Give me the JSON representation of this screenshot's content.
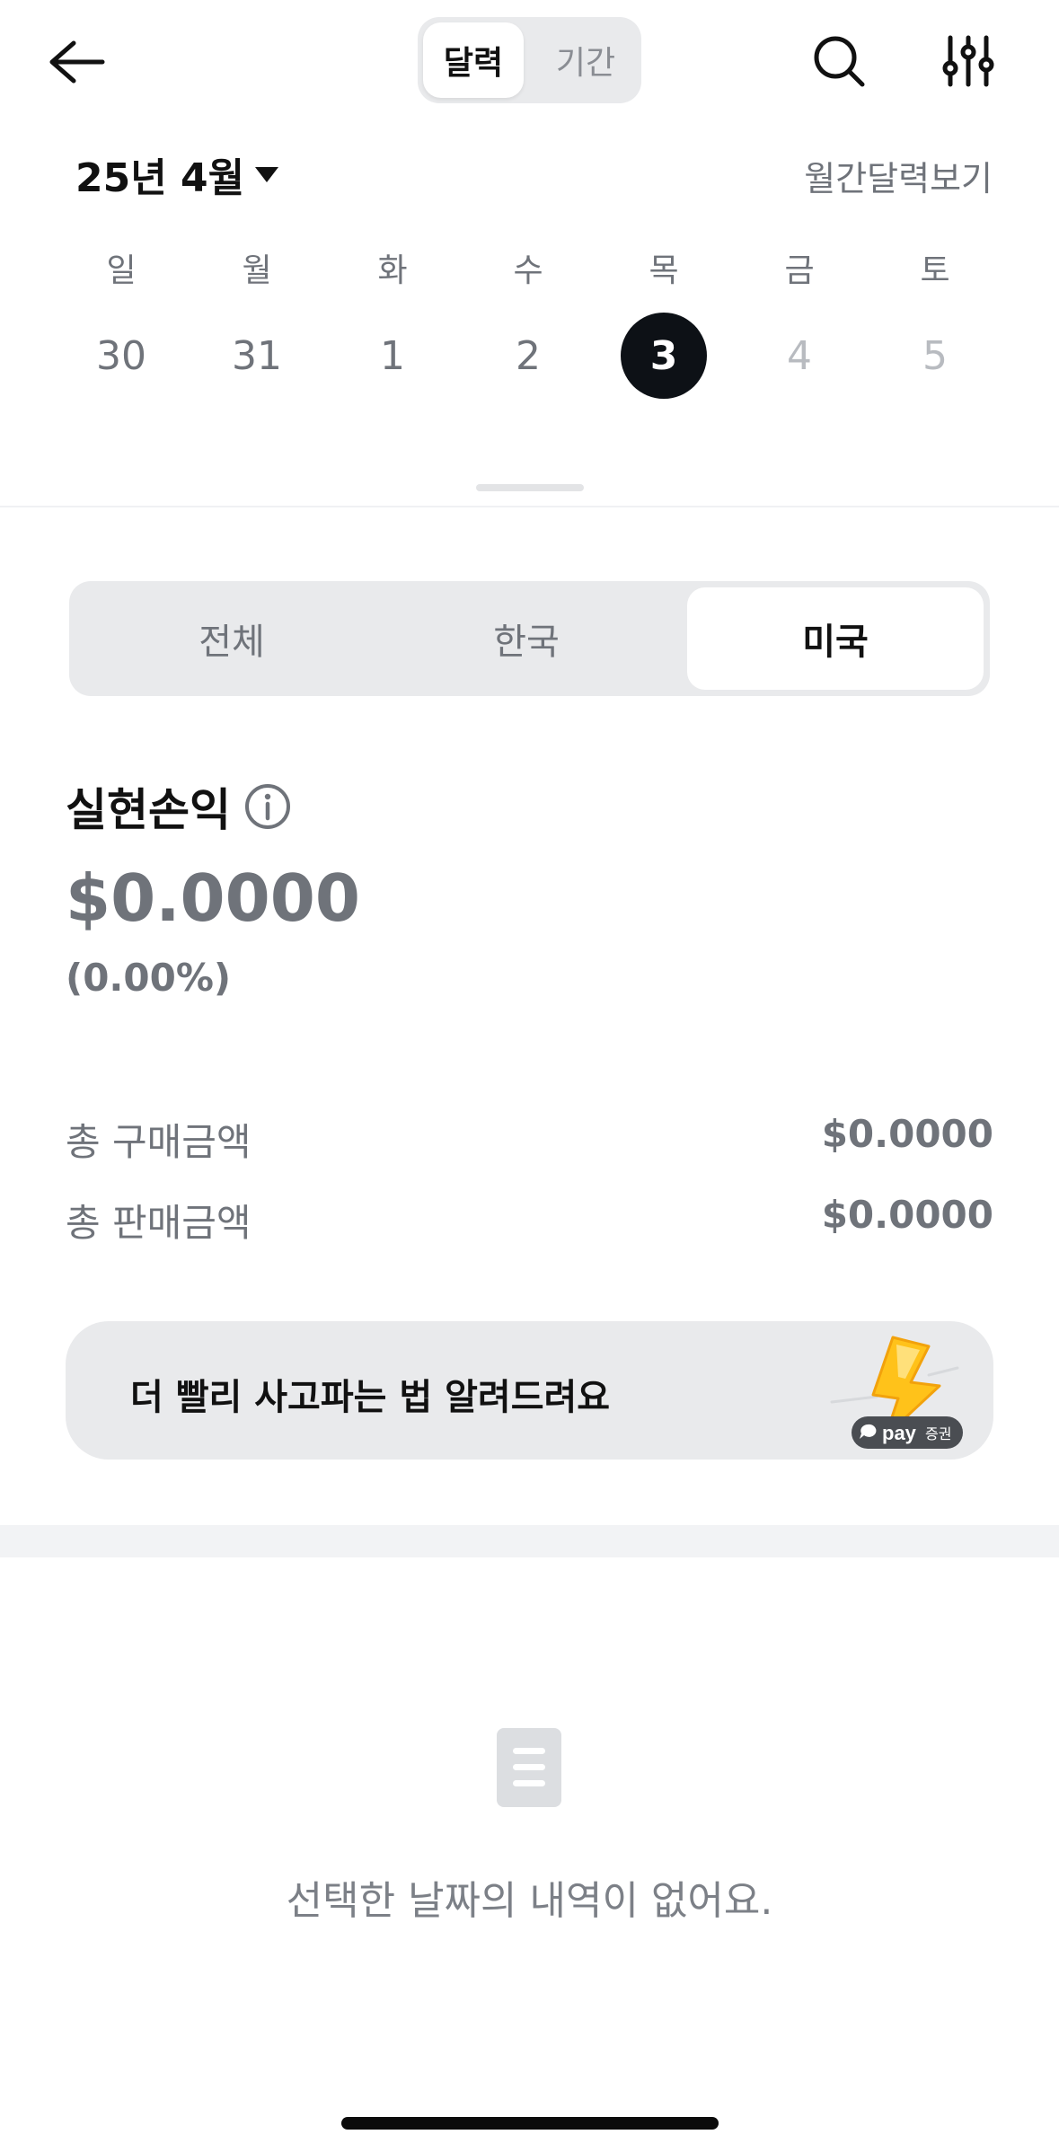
{
  "header": {
    "mode_options": [
      "달력",
      "기간"
    ],
    "selected_mode": "달력"
  },
  "month_selector": {
    "label": "25년 4월",
    "monthly_view_link": "월간달력보기"
  },
  "week": {
    "weekdays": [
      "일",
      "월",
      "화",
      "수",
      "목",
      "금",
      "토"
    ],
    "dates": [
      "30",
      "31",
      "1",
      "2",
      "3",
      "4",
      "5"
    ],
    "selected_date": "3"
  },
  "market_tabs": {
    "items": [
      "전체",
      "한국",
      "미국"
    ],
    "selected": "미국"
  },
  "realized_pl": {
    "title": "실현손익",
    "amount": "$0.0000",
    "rate": "(0.00%)"
  },
  "summary": {
    "total_buy_label": "총 구매금액",
    "total_buy_value": "$0.0000",
    "total_sell_label": "총 판매금액",
    "total_sell_value": "$0.0000"
  },
  "banner": {
    "text": "더 빨리 사고파는 법 알려드려요",
    "brand_pay": "pay",
    "brand_suffix": "증권"
  },
  "empty_state": {
    "message": "선택한 날짜의 내역이 없어요."
  },
  "colors": {
    "accent_selected": "#0d1116",
    "banner_bg": "#e9eaec",
    "bolt_yellow": "#ffc21a"
  }
}
